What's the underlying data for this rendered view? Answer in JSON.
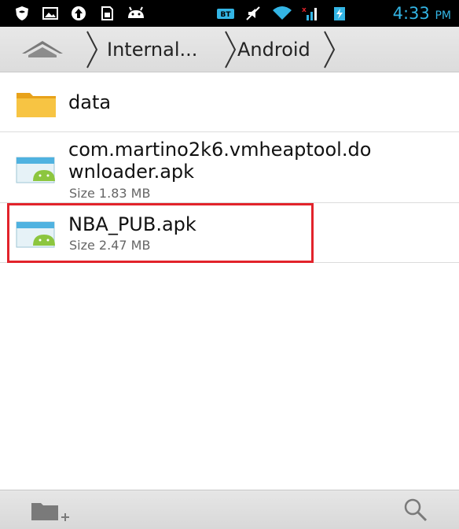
{
  "status_bar": {
    "time": "4:33",
    "ampm": "PM",
    "icons": [
      "shield-icon",
      "image-icon",
      "upload-icon",
      "sd-card-icon",
      "android-icon",
      "bluetooth-icon",
      "mute-icon",
      "wifi-icon",
      "signal-icon",
      "battery-charging-icon"
    ],
    "accent": "#33b5e5"
  },
  "breadcrumb": {
    "items": [
      {
        "label": "Internal..."
      },
      {
        "label": "Android"
      }
    ]
  },
  "files": [
    {
      "name": "data",
      "type": "folder"
    },
    {
      "name_line1": "com.martino2k6.vmheaptool.do",
      "name_line2": "wnloader.apk",
      "size": "Size 1.83 MB",
      "type": "apk"
    },
    {
      "name": "NBA_PUB.apk",
      "size": "Size 2.47 MB",
      "type": "apk",
      "highlighted": true
    }
  ],
  "bottom_bar": {
    "left_action": "new-folder-icon",
    "right_action": "search-icon"
  },
  "highlight_color": "#e2232b"
}
